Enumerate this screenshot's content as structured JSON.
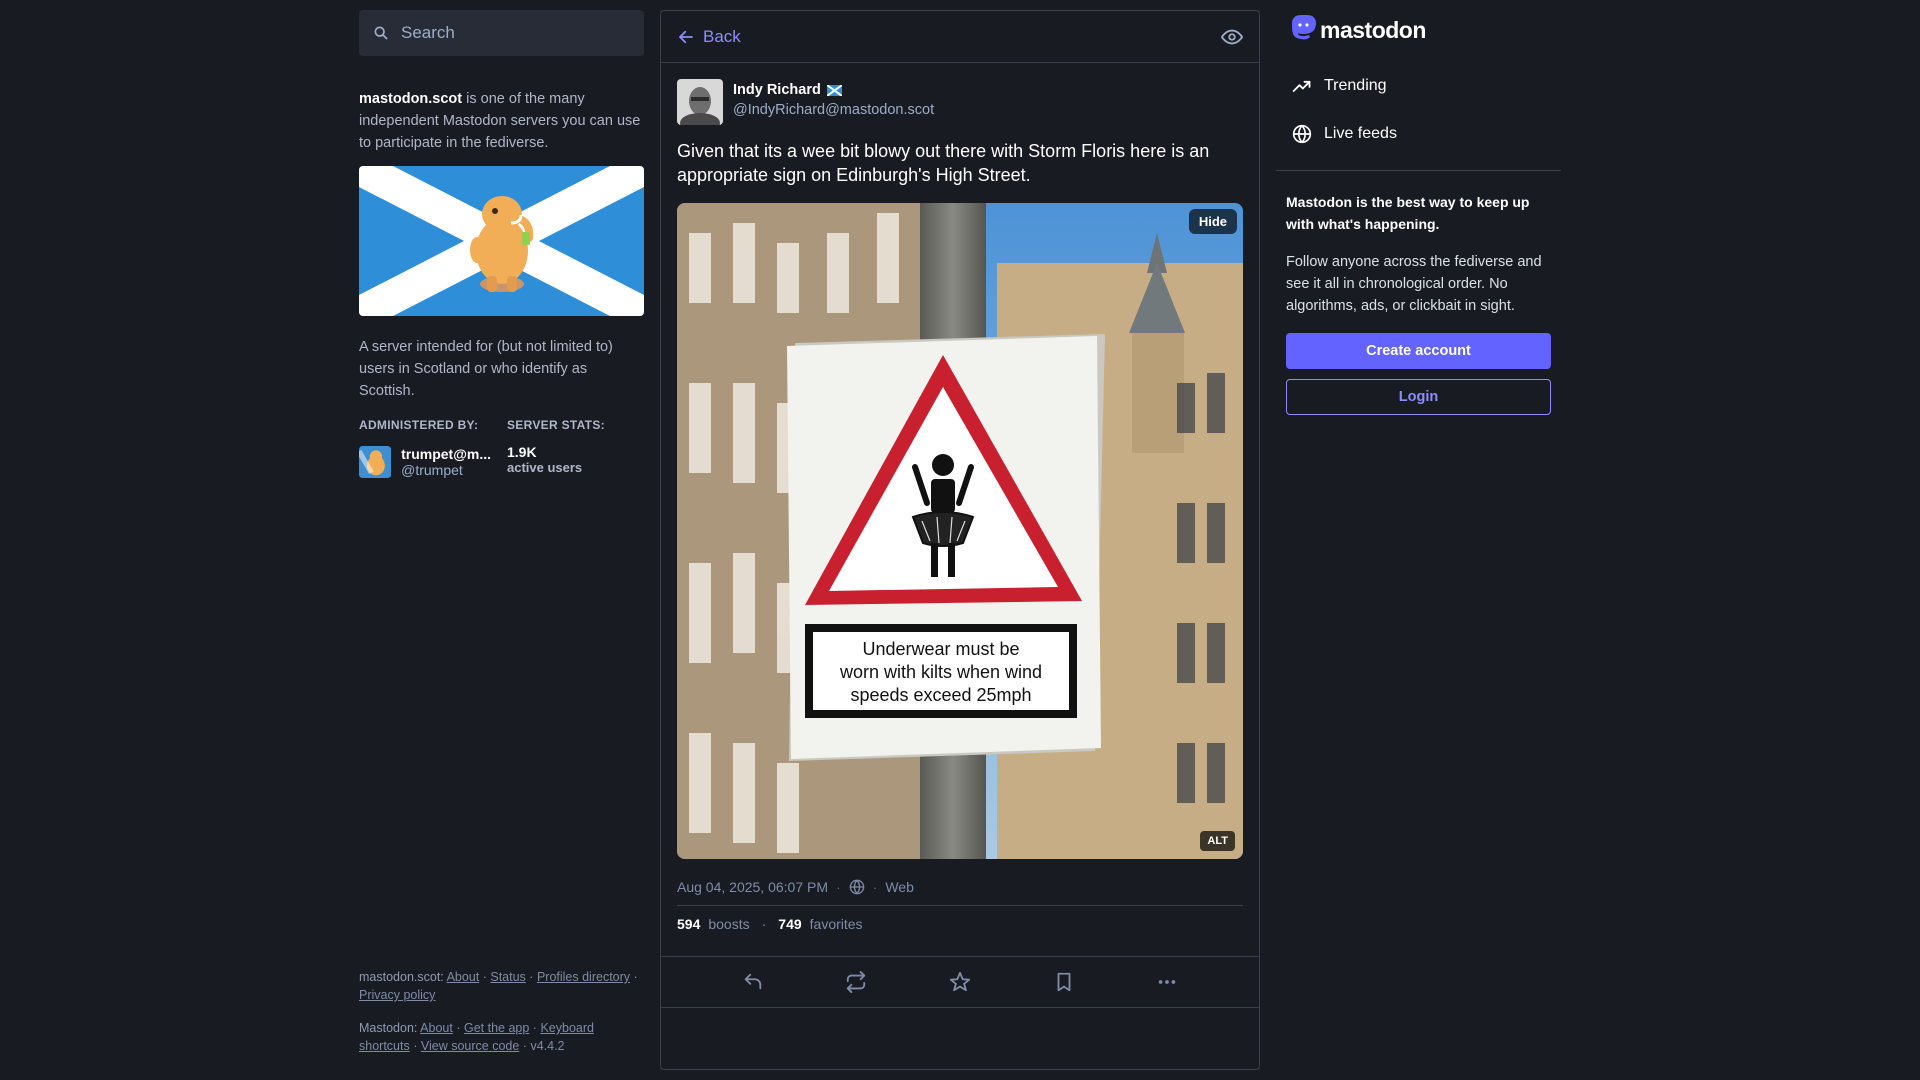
{
  "search": {
    "placeholder": "Search"
  },
  "server": {
    "domain": "mastodon.scot",
    "intro_rest": " is one of the many independent Mastodon servers you can use to participate in the fediverse.",
    "description": "A server intended for (but not limited to) users in Scotland or who identify as Scottish.",
    "administered_by_label": "ADMINISTERED BY:",
    "admin_name": "trumpet@m...",
    "admin_handle": "@trumpet",
    "server_stats_label": "SERVER STATS:",
    "active_users_count": "1.9K",
    "active_users_label": "active users"
  },
  "footer": {
    "server_label": "mastodon.scot:",
    "server_links": [
      "About",
      "Status",
      "Profiles directory",
      "Privacy policy"
    ],
    "mastodon_label": "Mastodon:",
    "mastodon_links": [
      "About",
      "Get the app",
      "Keyboard shortcuts",
      "View source code"
    ],
    "version": "v4.4.2",
    "sep": "·"
  },
  "header": {
    "back_label": "Back"
  },
  "status": {
    "author_name": "Indy Richard",
    "author_handle": "@IndyRichard@mastodon.scot",
    "text": "Given that its a wee bit blowy out there with Storm Floris here is an appropriate sign on Edinburgh's High Street.",
    "hide_label": "Hide",
    "alt_label": "ALT",
    "sign_lines": [
      "Underwear must be",
      "worn with kilts when wind",
      "speeds exceed 25mph"
    ],
    "date": "Aug 04, 2025, 06:07 PM",
    "meta_sep": "·",
    "app": "Web",
    "boosts_count": "594",
    "boosts_label": "boosts",
    "favorites_count": "749",
    "favorites_label": "favorites"
  },
  "right": {
    "logo_text": "mastodon",
    "nav_trending": "Trending",
    "nav_live_feeds": "Live feeds",
    "signup_heading": "Mastodon is the best way to keep up with what's happening.",
    "signup_text": "Follow anyone across the fediverse and see it all in chronological order. No algorithms, ads, or clickbait in sight.",
    "create_account": "Create account",
    "login": "Login"
  },
  "colors": {
    "background": "#191b22",
    "accent": "#6364ff",
    "link": "#8c8dff",
    "muted": "#9baec8",
    "saltire_blue": "#2e8fd8"
  },
  "icons": [
    "search-icon",
    "back-arrow-icon",
    "eye-icon",
    "globe-icon",
    "reply-icon",
    "boost-icon",
    "star-icon",
    "bookmark-icon",
    "more-icon",
    "trending-icon",
    "mastodon-logo-icon"
  ]
}
